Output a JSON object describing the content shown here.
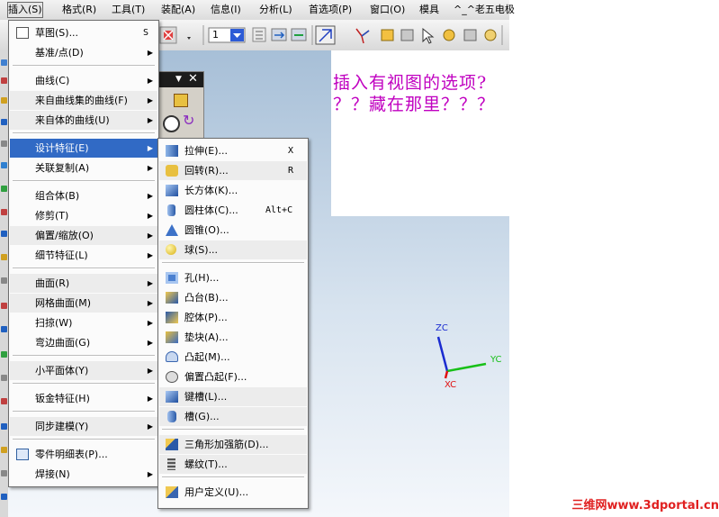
{
  "menubar": {
    "items": [
      "插入(S)",
      "格式(R)",
      "工具(T)",
      "装配(A)",
      "信息(I)",
      "分析(L)",
      "首选项(P)",
      "窗口(O)",
      "模具",
      "^_^老五电极"
    ]
  },
  "toolbar": {
    "layer_value": "1"
  },
  "annotation": {
    "line1": "插入有视图的选项?",
    "line2": "？？藏在那里？？？"
  },
  "insert_menu": {
    "items": [
      {
        "label": "草图(S)...",
        "shortcut": "S",
        "icon": "sketch-icon"
      },
      {
        "label": "基准/点(D)",
        "submenu": true
      },
      {
        "label": "曲线(C)",
        "submenu": true
      },
      {
        "label": "来自曲线集的曲线(F)",
        "submenu": true
      },
      {
        "label": "来自体的曲线(U)",
        "submenu": true
      },
      {
        "label": "设计特征(E)",
        "submenu": true,
        "highlighted": true
      },
      {
        "label": "关联复制(A)",
        "submenu": true
      },
      {
        "label": "组合体(B)",
        "submenu": true
      },
      {
        "label": "修剪(T)",
        "submenu": true
      },
      {
        "label": "偏置/缩放(O)",
        "submenu": true
      },
      {
        "label": "细节特征(L)",
        "submenu": true
      },
      {
        "label": "曲面(R)",
        "submenu": true
      },
      {
        "label": "网格曲面(M)",
        "submenu": true
      },
      {
        "label": "扫掠(W)",
        "submenu": true
      },
      {
        "label": "弯边曲面(G)",
        "submenu": true
      },
      {
        "label": "小平面体(Y)",
        "submenu": true
      },
      {
        "label": "钣金特征(H)",
        "submenu": true
      },
      {
        "label": "同步建模(Y)",
        "submenu": true
      },
      {
        "label": "零件明细表(P)...",
        "icon": "parts-list-icon"
      },
      {
        "label": "焊接(N)",
        "submenu": true
      }
    ]
  },
  "design_feature_menu": {
    "items": [
      {
        "label": "拉伸(E)...",
        "shortcut": "X",
        "icon": "extrude-icon"
      },
      {
        "label": "回转(R)...",
        "shortcut": "R",
        "icon": "revolve-icon"
      },
      {
        "label": "长方体(K)...",
        "icon": "block-icon"
      },
      {
        "label": "圆柱体(C)...",
        "shortcut": "Alt+C",
        "icon": "cylinder-icon"
      },
      {
        "label": "圆锥(O)...",
        "icon": "cone-icon"
      },
      {
        "label": "球(S)...",
        "icon": "sphere-icon"
      },
      {
        "label": "孔(H)...",
        "icon": "hole-icon"
      },
      {
        "label": "凸台(B)...",
        "icon": "boss-icon"
      },
      {
        "label": "腔体(P)...",
        "icon": "pocket-icon"
      },
      {
        "label": "垫块(A)...",
        "icon": "pad-icon"
      },
      {
        "label": "凸起(M)...",
        "icon": "emboss-icon"
      },
      {
        "label": "偏置凸起(F)...",
        "icon": "offset-emboss-icon"
      },
      {
        "label": "键槽(L)...",
        "icon": "slot-icon"
      },
      {
        "label": "槽(G)...",
        "icon": "groove-icon"
      },
      {
        "label": "三角形加强筋(D)...",
        "icon": "dart-icon"
      },
      {
        "label": "螺纹(T)...",
        "icon": "thread-icon"
      },
      {
        "label": "用户定义(U)...",
        "icon": "user-defined-icon"
      }
    ]
  },
  "axes": {
    "zc": "ZC",
    "yc": "YC",
    "xc": "XC"
  },
  "watermark": "三维网www.3dportal.cn",
  "colors": {
    "highlight": "#316ac5",
    "annotation": "#c000c0",
    "axis_z": "#1a2bd0",
    "axis_y": "#18c018",
    "axis_x": "#e01010",
    "watermark": "#e02020"
  }
}
